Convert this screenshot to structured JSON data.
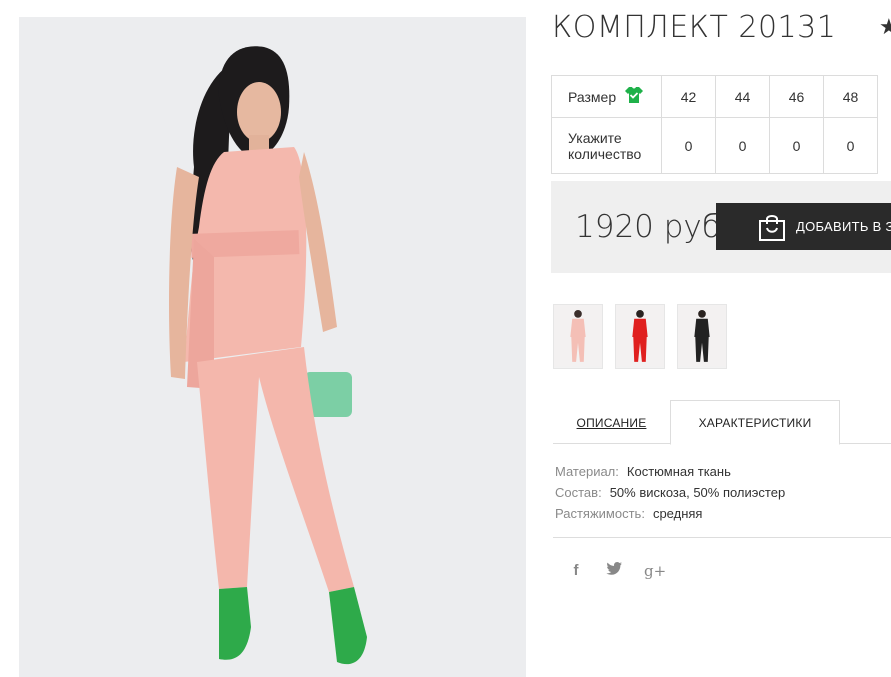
{
  "product": {
    "title": "КОМПЛЕКТ 20131",
    "favorite_icon": "star-icon"
  },
  "sizes": {
    "size_label": "Размер",
    "size_icon": "shirt-check-icon",
    "qty_label_line1": "Укажите",
    "qty_label_line2": "количество",
    "values": [
      "42",
      "44",
      "46",
      "48"
    ],
    "quantities": [
      "0",
      "0",
      "0",
      "0"
    ]
  },
  "price": {
    "value": "1920 руб",
    "buy_label": "ДОБАВИТЬ В ЗА"
  },
  "tabs": {
    "description": "ОПИСАНИЕ",
    "characteristics": "ХАРАКТЕРИСТИКИ"
  },
  "characteristics": [
    {
      "key": "Материал:",
      "value": "Костюмная ткань"
    },
    {
      "key": "Состав:",
      "value": "50% вискоза, 50% полиэстер"
    },
    {
      "key": "Растяжимость:",
      "value": "средняя"
    }
  ],
  "social": {
    "facebook": "f",
    "twitter": "twitter-icon",
    "googleplus": "g+"
  },
  "colors": {
    "dark_button": "#2a2a2a",
    "accent_green": "#1fb14a",
    "price_bg": "#efefef"
  }
}
